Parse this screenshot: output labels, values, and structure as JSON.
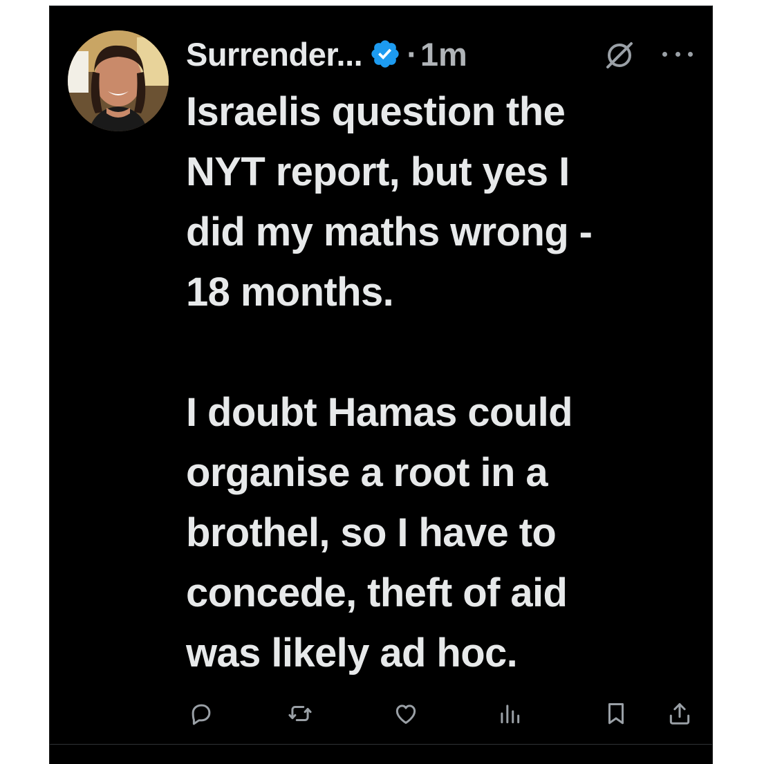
{
  "author": {
    "display_name": "Surrender...",
    "verified_icon": "verified-badge-icon",
    "separator": "·",
    "timestamp": "1m"
  },
  "header_icons": {
    "grok": "grok-icon",
    "more": "more-options-icon"
  },
  "tweet": {
    "paragraphs": [
      {
        "lines": [
          "Israelis question the",
          "NYT report, but yes I",
          "did my maths wrong -",
          "18 months."
        ]
      },
      {
        "lines": [
          "I doubt Hamas could",
          "organise a root in a",
          "brothel, so I have to",
          "concede, theft of aid",
          "was likely ad hoc."
        ]
      }
    ]
  },
  "actions": [
    {
      "name": "reply",
      "icon": "reply-icon"
    },
    {
      "name": "repost",
      "icon": "repost-icon"
    },
    {
      "name": "like",
      "icon": "like-icon"
    },
    {
      "name": "views",
      "icon": "views-icon"
    },
    {
      "name": "bookmark",
      "icon": "bookmark-icon"
    },
    {
      "name": "share",
      "icon": "share-icon"
    }
  ],
  "colors": {
    "background": "#000000",
    "text_primary": "#e7e9ea",
    "text_secondary": "#b0b4b8",
    "verified_blue": "#1d9bf0",
    "icon_gray": "#9aa0a6"
  }
}
